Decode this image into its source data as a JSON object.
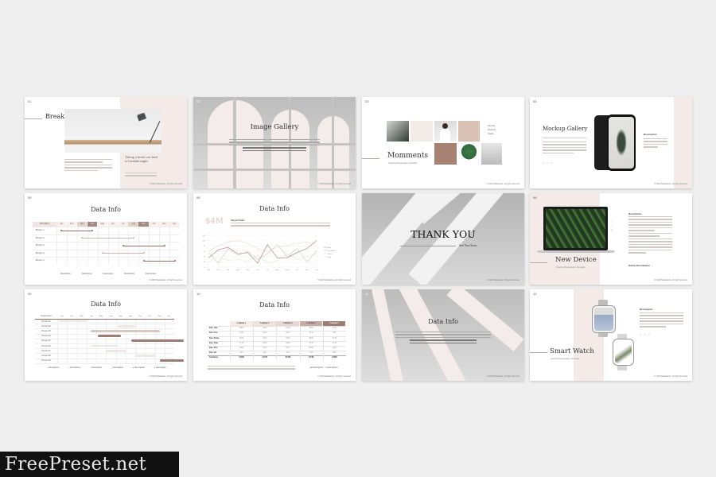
{
  "slides": [
    {
      "number": "01",
      "title": "Break Time",
      "quote": "Taking a break can lead to breakthroughs",
      "footer": "© 2020 Madeleine. All right reserved"
    },
    {
      "number": "02",
      "title": "Image Gallery",
      "footer": "© 2020 Madeleine. All right reserved"
    },
    {
      "number": "03",
      "title": "Momments",
      "subtitle": "Inspiring Presentation Template",
      "keywords": [
        "Simple",
        "Natural",
        "Clean"
      ],
      "footer": "© 2020 Madeleine. All right reserved"
    },
    {
      "number": "04",
      "title": "Mockup Gallery",
      "side_heading": "Description",
      "footer": "© 2020 Madeleine. All right reserved"
    },
    {
      "number": "05",
      "title": "Data Info",
      "gantt": {
        "header": "PROJECT",
        "months": [
          "Jan",
          "Feb",
          "Mar",
          "Apr",
          "May",
          "Jun",
          "Jul",
          "Aug",
          "Sep",
          "Oct",
          "Nov",
          "Dec"
        ],
        "projects": [
          {
            "name": "Project 1",
            "start": 1,
            "end": 4
          },
          {
            "name": "Project 2",
            "start": 3,
            "end": 8
          },
          {
            "name": "Project 3",
            "start": 7,
            "end": 11
          },
          {
            "name": "Project 4",
            "start": 5,
            "end": 9
          },
          {
            "name": "Project 5",
            "start": 9,
            "end": 12
          }
        ],
        "legend": [
          "Description",
          "Description",
          "Description",
          "Description",
          "Description"
        ]
      },
      "footer": "© 2020 Madeleine. All right reserved"
    },
    {
      "number": "06",
      "title": "Data Info",
      "stat": "$4M",
      "about_heading": "About Chart",
      "chart": {
        "months": [
          "Jan",
          "Feb",
          "Mar",
          "April",
          "May",
          "Jun",
          "Jul",
          "Aug",
          "Sept",
          "Oct",
          "Nov",
          "Dec"
        ],
        "y_ticks": [
          0,
          20,
          40,
          60,
          80,
          100,
          120
        ],
        "series": [
          {
            "name": "Data",
            "values": [
              35,
              65,
              75,
              50,
              55,
              15,
              85,
              35,
              35,
              55,
              70,
              100
            ]
          },
          {
            "name": "Description",
            "values": [
              55,
              15,
              70,
              45,
              60,
              30,
              50,
              85,
              40,
              70,
              20,
              60
            ]
          },
          {
            "name": "Others",
            "values": [
              60,
              80,
              95,
              100,
              90,
              70,
              60,
              75,
              80,
              90,
              95,
              85
            ]
          },
          {
            "name": "Total",
            "values": [
              20,
              40,
              25,
              30,
              20,
              45,
              15,
              25,
              50,
              30,
              40,
              50
            ]
          }
        ],
        "legend": [
          "Data",
          "Description",
          "Others",
          "Total"
        ]
      },
      "footer": "© 2020 Madeleine. All right reserved"
    },
    {
      "number": "07",
      "title": "THANK YOU",
      "subtitle": "See You Soon",
      "footer": "© 2020 Madeleine. All right reserved"
    },
    {
      "number": "08",
      "title": "New Device",
      "subtitle": "Inspiring Presentation Template",
      "side_heading": "Description",
      "side_footer": "Online Distribution",
      "footer": "© 2020 Madeleine. All right reserved"
    },
    {
      "number": "09",
      "title": "Data Info",
      "gantt2": {
        "header": "Progression",
        "months": [
          "Jan",
          "Feb",
          "Mar",
          "Apr",
          "May",
          "June",
          "July",
          "Aug",
          "Sep",
          "Oct",
          "Nov",
          "Dec"
        ],
        "rows": [
          "Process 01",
          "Process 02",
          "Process 03",
          "Process 04",
          "Process 05",
          "Process 06",
          "Process 07",
          "Process 08",
          "Process 09"
        ],
        "legend": [
          "Description",
          "Description",
          "Description",
          "Description",
          "Description",
          "Description"
        ]
      },
      "footer": "© 2020 Madeleine. All right reserved"
    },
    {
      "number": "10",
      "title": "Data Info",
      "table": {
        "columns": [
          "",
          "Column 1",
          "Column 2",
          "Column 3",
          "Column 4",
          "Column 5"
        ],
        "rows": [
          [
            "Row One",
            "$800",
            "$900",
            "$500",
            "$600",
            "$100"
          ],
          [
            "Row Two",
            "$350",
            "$250",
            "$250",
            "$350",
            "$80"
          ],
          [
            "Row Three",
            "$500",
            "$300",
            "$430",
            "$900",
            "$230"
          ],
          [
            "Row Four",
            "$750",
            "$250",
            "$400",
            "$150",
            "$150"
          ],
          [
            "Row Five",
            "$600",
            "$250",
            "$330",
            "$800",
            "$400"
          ],
          [
            "Row Six",
            "$40",
            "$70",
            "$50",
            "$80",
            "$90"
          ],
          [
            "Total Row",
            "$1900",
            "$1700",
            "$1900",
            "$2700",
            "$1000"
          ]
        ]
      },
      "legend": [
        "Description",
        "Description"
      ],
      "footer": "© 2020 Madeleine. All right reserved"
    },
    {
      "number": "11",
      "title": "Data Info",
      "footer": "© 2020 Madeleine. All right reserved"
    },
    {
      "number": "12",
      "title": "Smart Watch",
      "subtitle": "Inspiring Presentation Template",
      "side_heading": "Description",
      "footer": "© 2020 Madeleine. All right reserved"
    }
  ],
  "watermark": "FreePreset.net",
  "colors": {
    "accent": "#a98a80",
    "pink": "#f4ebe8",
    "dark_brown": "#8c6e63"
  }
}
